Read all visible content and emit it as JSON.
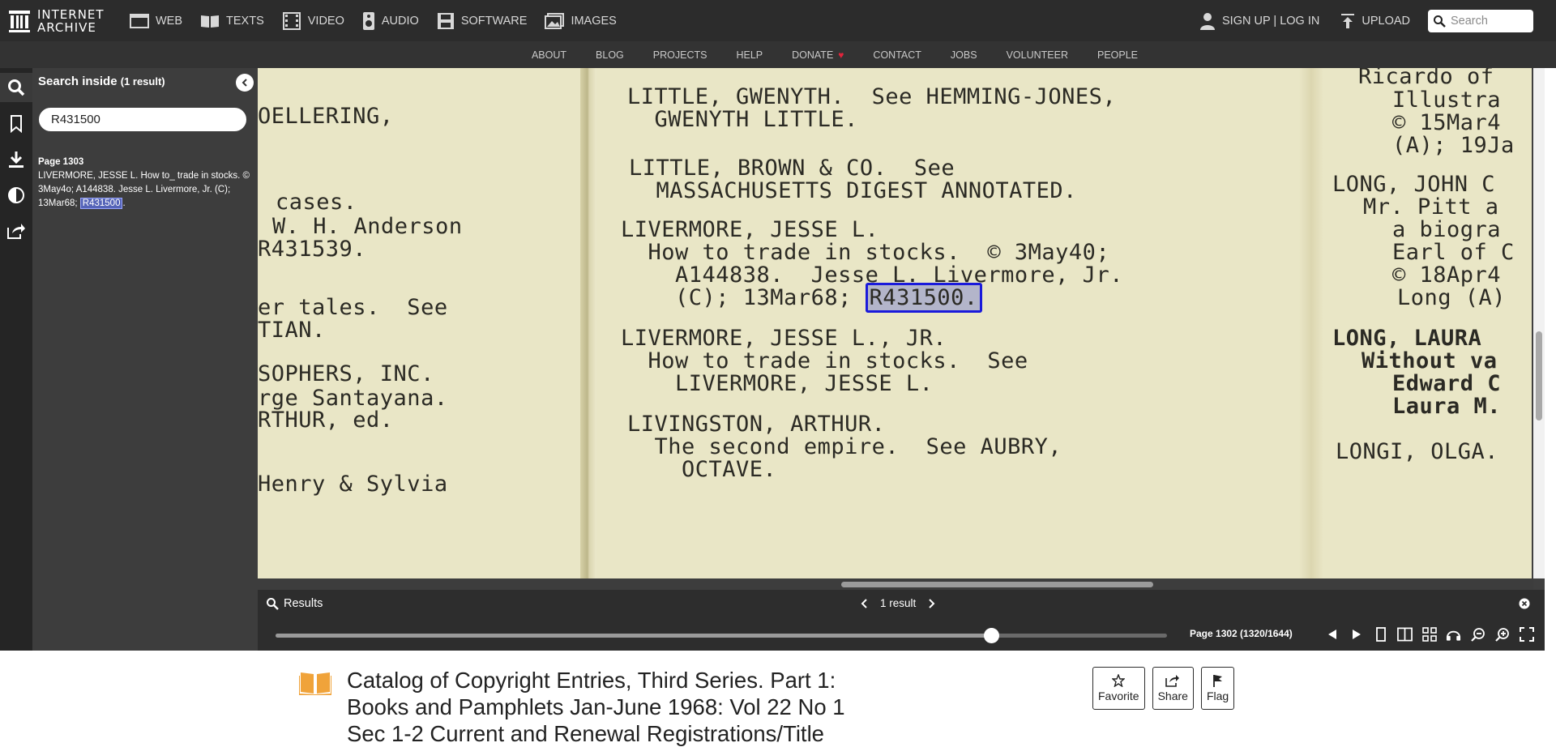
{
  "header": {
    "logo_line1": "INTERNET",
    "logo_line2": "ARCHIVE",
    "media": [
      {
        "label": "WEB",
        "icon": "web-icon"
      },
      {
        "label": "TEXTS",
        "icon": "book-icon"
      },
      {
        "label": "VIDEO",
        "icon": "film-icon"
      },
      {
        "label": "AUDIO",
        "icon": "speaker-icon"
      },
      {
        "label": "SOFTWARE",
        "icon": "floppy-icon"
      },
      {
        "label": "IMAGES",
        "icon": "image-icon"
      }
    ],
    "signup": "SIGN UP | LOG IN",
    "upload": "UPLOAD",
    "search_placeholder": "Search"
  },
  "subnav": [
    "ABOUT",
    "BLOG",
    "PROJECTS",
    "HELP",
    "DONATE",
    "CONTACT",
    "JOBS",
    "VOLUNTEER",
    "PEOPLE"
  ],
  "search_panel": {
    "title": "Search inside",
    "count": "(1 result)",
    "query": "R431500",
    "result_page": "Page 1303",
    "result_text": "LIVERMORE, JESSE L. How to_ trade in stocks. © 3May4o; A144838. Jesse L. Livermore, Jr. (C); 13Mar68; ",
    "result_match": "R431500",
    "result_tail": "."
  },
  "scan": {
    "left_col": [
      "OELLERING,",
      "cases.",
      "W. H. Anderson",
      "R431539.",
      "er tales.  See",
      "TIAN.",
      "SOPHERS, INC.",
      "rge Santayana.",
      "RTHUR, ed.",
      "Henry & Sylvia"
    ],
    "mid_col": [
      "LITTLE, GWENYTH.  See HEMMING-JONES,",
      "  GWENYTH LITTLE.",
      "LITTLE, BROWN & CO.  See",
      "  MASSACHUSETTS DIGEST ANNOTATED.",
      "LIVERMORE, JESSE L.",
      "  How to trade in stocks.  © 3May40;",
      "    A144838.  Jesse L. Livermore, Jr.",
      "    (C); 13Mar68; ",
      "R431500.",
      "LIVERMORE, JESSE L., JR.",
      "  How to trade in stocks.  See",
      "    LIVERMORE, JESSE L.",
      "LIVINGSTON, ARTHUR.",
      "  The second empire.  See AUBRY,",
      "    OCTAVE."
    ],
    "right_col": [
      "Ricardo of",
      "Illustra",
      "© 15Mar4",
      "(A); 19Ja",
      "LONG, JOHN C",
      "Mr. Pitt a",
      "a biogra",
      "Earl of C",
      "© 18Apr4",
      "Long (A)",
      "LONG, LAURA",
      "Without va",
      "Edward C",
      "Laura M.",
      "LONGI, OLGA."
    ]
  },
  "results_bar": {
    "label": "Results",
    "count": "1 result"
  },
  "nav": {
    "page_label": "Page 1302 (1320/1644)",
    "progress": 0.8029
  },
  "item": {
    "title_lines": [
      "Catalog of Copyright Entries, Third Series. Part 1:",
      "Books and Pamphlets Jan-June 1968: Vol 22 No 1",
      "Sec 1-2 Current and Renewal Registrations/Title"
    ],
    "favorite": "Favorite",
    "share": "Share",
    "flag": "Flag"
  }
}
